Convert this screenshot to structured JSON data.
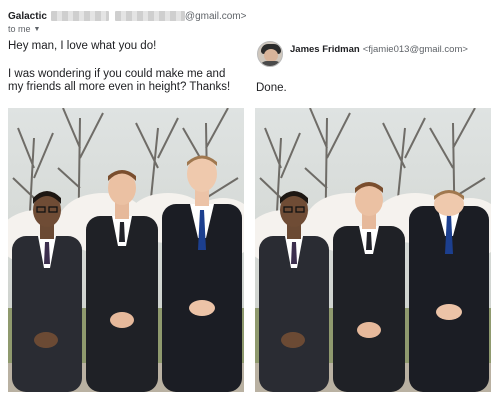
{
  "request": {
    "sender_name": "Galactic",
    "sender_email_suffix": "@gmail.com>",
    "to_label": "to me",
    "message_line1": "Hey man, I love what you do!",
    "message_line2a": "I was wondering if you could make me and",
    "message_line2b": "my friends all more even in height? Thanks!"
  },
  "reply": {
    "sender_name": "James Fridman",
    "sender_email": "<fjamie013@gmail.com>",
    "message": "Done."
  },
  "icons": {
    "caret": "chevron-down-icon",
    "avatar": "avatar"
  },
  "colors": {
    "suit": "#1f2024",
    "shirt": "#ffffff",
    "tie_blue": "#1c3f8f",
    "tie_dark": "#2a2a3a",
    "sky": "#e8ebe9",
    "blossom": "#f4f1ec",
    "grass": "#9aa57a"
  }
}
